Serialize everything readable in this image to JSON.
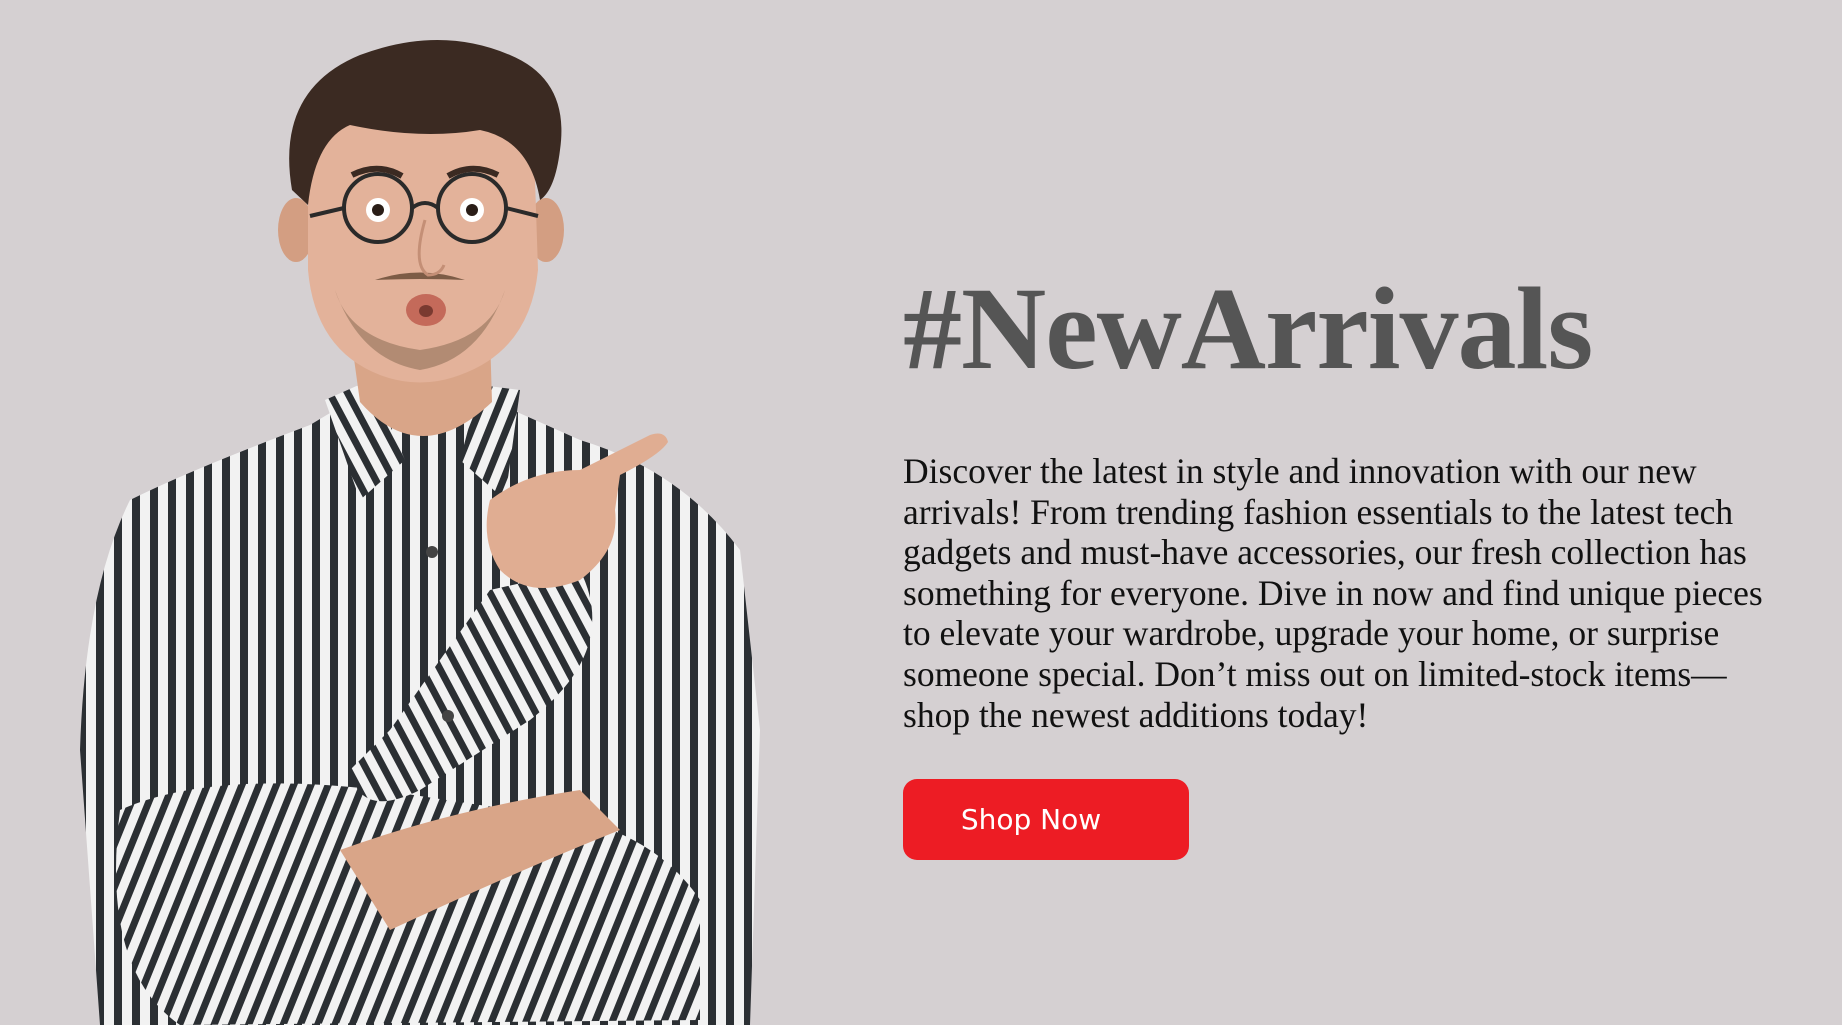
{
  "hero": {
    "image_alt": "man in striped shirt with glasses pointing",
    "headline": "#NewArrivals",
    "description": "Discover the latest in style and innovation with our new arrivals! From trending fashion essentials to the latest tech gadgets and must-have accessories, our fresh collection has something for everyone. Dive in now and find unique pieces to elevate your wardrobe, upgrade your home, or surprise someone special. Don’t miss out on limited-stock items—shop the newest additions today!",
    "cta_label": "Shop Now"
  },
  "colors": {
    "background": "#d5d0d2",
    "headline": "#555555",
    "body_text": "#111111",
    "cta_background": "#ed1c24",
    "cta_text": "#ffffff"
  }
}
